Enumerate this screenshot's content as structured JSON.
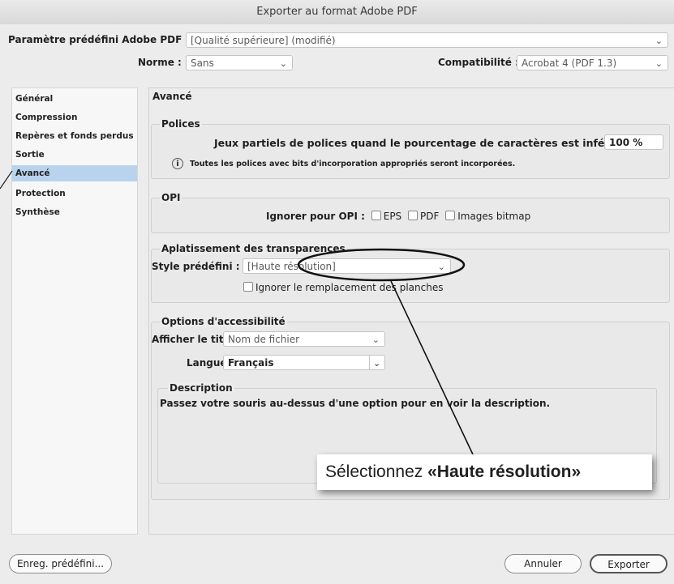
{
  "window": {
    "title": "Exporter au format Adobe PDF"
  },
  "preset": {
    "label": "Paramètre prédéfini Adobe PDF :",
    "value": "[Qualité supérieure] (modifié)"
  },
  "standard": {
    "label": "Norme :",
    "value": "Sans"
  },
  "compat": {
    "label": "Compatibilité :",
    "value": "Acrobat 4 (PDF 1.3)"
  },
  "sidebar": {
    "items": [
      {
        "label": "Général"
      },
      {
        "label": "Compression"
      },
      {
        "label": "Repères et fonds perdus"
      },
      {
        "label": "Sortie"
      },
      {
        "label": "Avancé",
        "selected": true
      },
      {
        "label": "Protection"
      },
      {
        "label": "Synthèse"
      }
    ]
  },
  "main": {
    "heading": "Avancé",
    "fonts": {
      "title": "Polices",
      "subset_label": "Jeux partiels de polices quand le pourcentage de caractères est inférieur à :",
      "subset_value": "100 %",
      "info": "Toutes les polices avec bits d'incorporation appropriés seront incorporées."
    },
    "opi": {
      "title": "OPI",
      "label": "Ignorer pour OPI :",
      "options": [
        "EPS",
        "PDF",
        "Images bitmap"
      ]
    },
    "flatten": {
      "title": "Aplatissement des transparences",
      "preset_label": "Style prédéfini :",
      "preset_value": "[Haute résolution]",
      "ignore_label": "Ignorer le remplacement des planches"
    },
    "access": {
      "title": "Options d'accessibilité",
      "show_title_label": "Afficher le titre :",
      "show_title_value": "Nom de fichier",
      "lang_label": "Langue :",
      "lang_value": "Français"
    },
    "description": {
      "title": "Description",
      "text": "Passez votre souris au-dessus d'une option pour en voir la description."
    }
  },
  "callout": {
    "prefix": "Sélectionnez ",
    "emphasis": "«Haute résolution»"
  },
  "buttons": {
    "save_preset": "Enreg. prédéfini...",
    "cancel": "Annuler",
    "export": "Exporter"
  },
  "icons": {
    "chevron": "chevron-down-icon",
    "info": "info-icon"
  },
  "colors": {
    "selection": "#b9d3ee",
    "dialog_bg": "#ececec"
  }
}
